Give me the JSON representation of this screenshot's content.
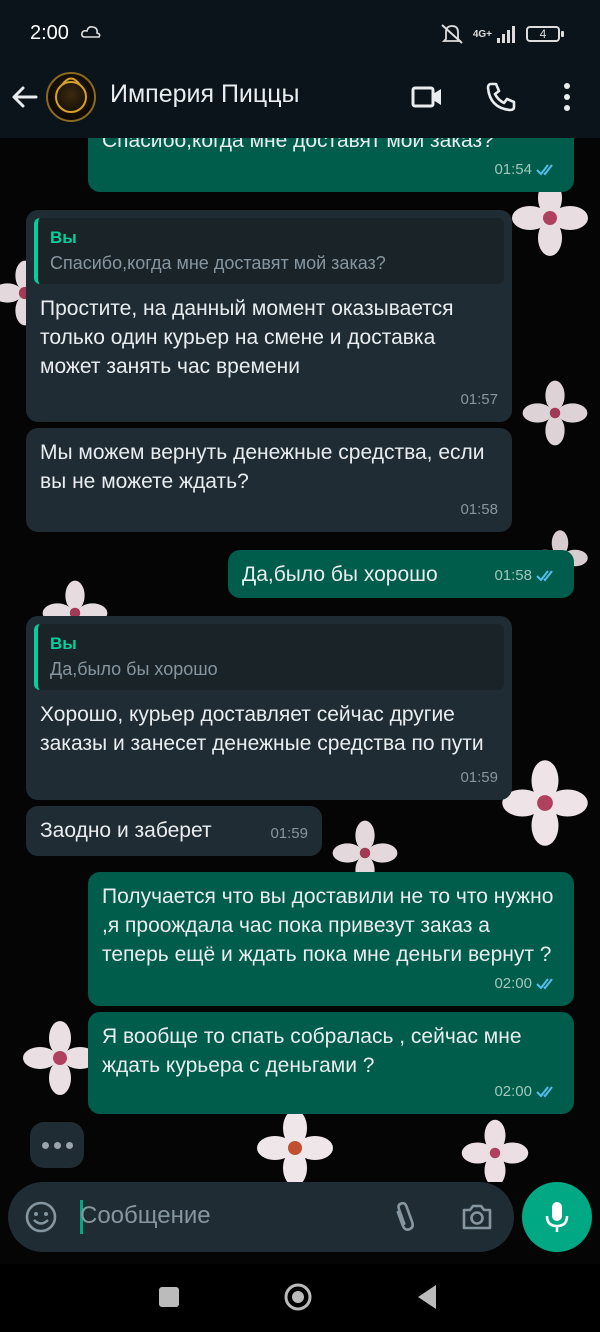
{
  "status_bar": {
    "time": "2:00",
    "network": "4G+",
    "battery": "4"
  },
  "header": {
    "contact_name": "Империя Пиццы"
  },
  "messages": [
    {
      "dir": "out",
      "text": "Спасибо,когда мне доставят мой заказ?",
      "time": "01:54"
    },
    {
      "dir": "in",
      "quote_author": "Вы",
      "quote_text": "Спасибо,когда мне доставят мой заказ?",
      "text": "Простите, на данный момент оказывается только один курьер на смене и доставка может занять час времени",
      "time": "01:57"
    },
    {
      "dir": "in",
      "text": "Мы можем вернуть денежные средства, если вы не можете ждать?",
      "time": "01:58"
    },
    {
      "dir": "out",
      "text": "Да,было бы хорошо",
      "time": "01:58"
    },
    {
      "dir": "in",
      "quote_author": "Вы",
      "quote_text": "Да,было бы хорошо",
      "text": "Хорошо, курьер доставляет сейчас другие заказы и занесет денежные средства по пути",
      "time": "01:59"
    },
    {
      "dir": "in",
      "text": "Заодно и заберет",
      "time": "01:59"
    },
    {
      "dir": "out",
      "text": "Получается что вы доставили не то что нужно ,я проождала час пока привезут заказ а теперь ещё и ждать пока мне деньги вернут ?",
      "time": "02:00"
    },
    {
      "dir": "out",
      "text": "Я вообще то спать собралась , сейчас мне ждать курьера с деньгами ?",
      "time": "02:00"
    }
  ],
  "composer": {
    "placeholder": "Сообщение"
  },
  "colors": {
    "outgoing_bubble": "#005c4b",
    "incoming_bubble": "#202c33",
    "accent": "#00a884",
    "read_ticks": "#53bdeb"
  }
}
